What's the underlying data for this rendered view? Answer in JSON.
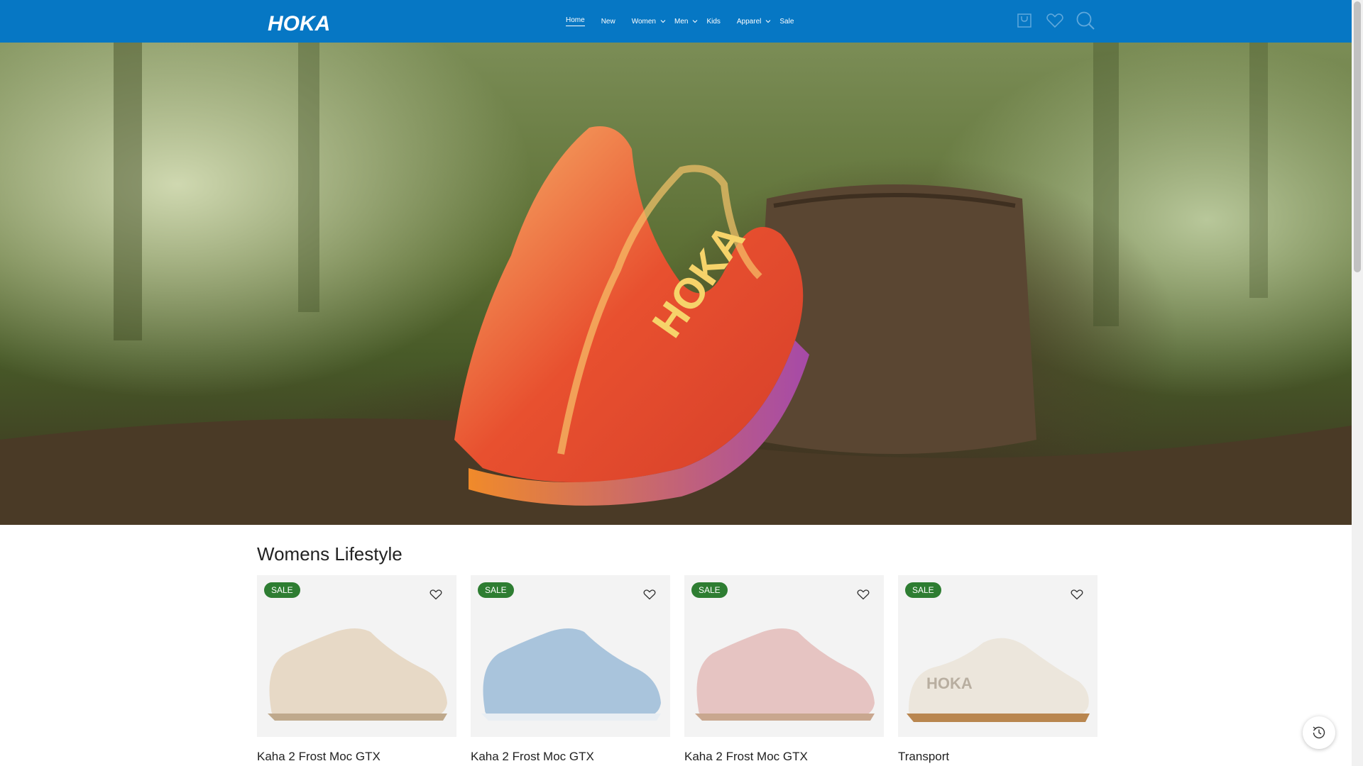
{
  "brand": {
    "logo_text": "HOKA"
  },
  "nav": {
    "items": [
      {
        "label": "Home",
        "active": true,
        "dropdown": false
      },
      {
        "label": "New",
        "active": false,
        "dropdown": false
      },
      {
        "label": "Women",
        "active": false,
        "dropdown": true
      },
      {
        "label": "Men",
        "active": false,
        "dropdown": true
      },
      {
        "label": "Kids",
        "active": false,
        "dropdown": false
      },
      {
        "label": "Apparel",
        "active": false,
        "dropdown": true
      },
      {
        "label": "Sale",
        "active": false,
        "dropdown": false
      }
    ]
  },
  "header_icons": [
    "cart-icon",
    "heart-icon",
    "search-icon"
  ],
  "section": {
    "title": "Womens Lifestyle",
    "products": [
      {
        "name": "Kaha 2 Frost Moc GTX",
        "badge": "SALE",
        "color": "#e7d9c6"
      },
      {
        "name": "Kaha 2 Frost Moc GTX",
        "badge": "SALE",
        "color": "#a9c4dc"
      },
      {
        "name": "Kaha 2 Frost Moc GTX",
        "badge": "SALE",
        "color": "#e6c4c2"
      },
      {
        "name": "Transport",
        "badge": "SALE",
        "color": "#ece6dc"
      }
    ]
  },
  "colors": {
    "header": "#0677c4",
    "sale": "#2e7d32"
  }
}
